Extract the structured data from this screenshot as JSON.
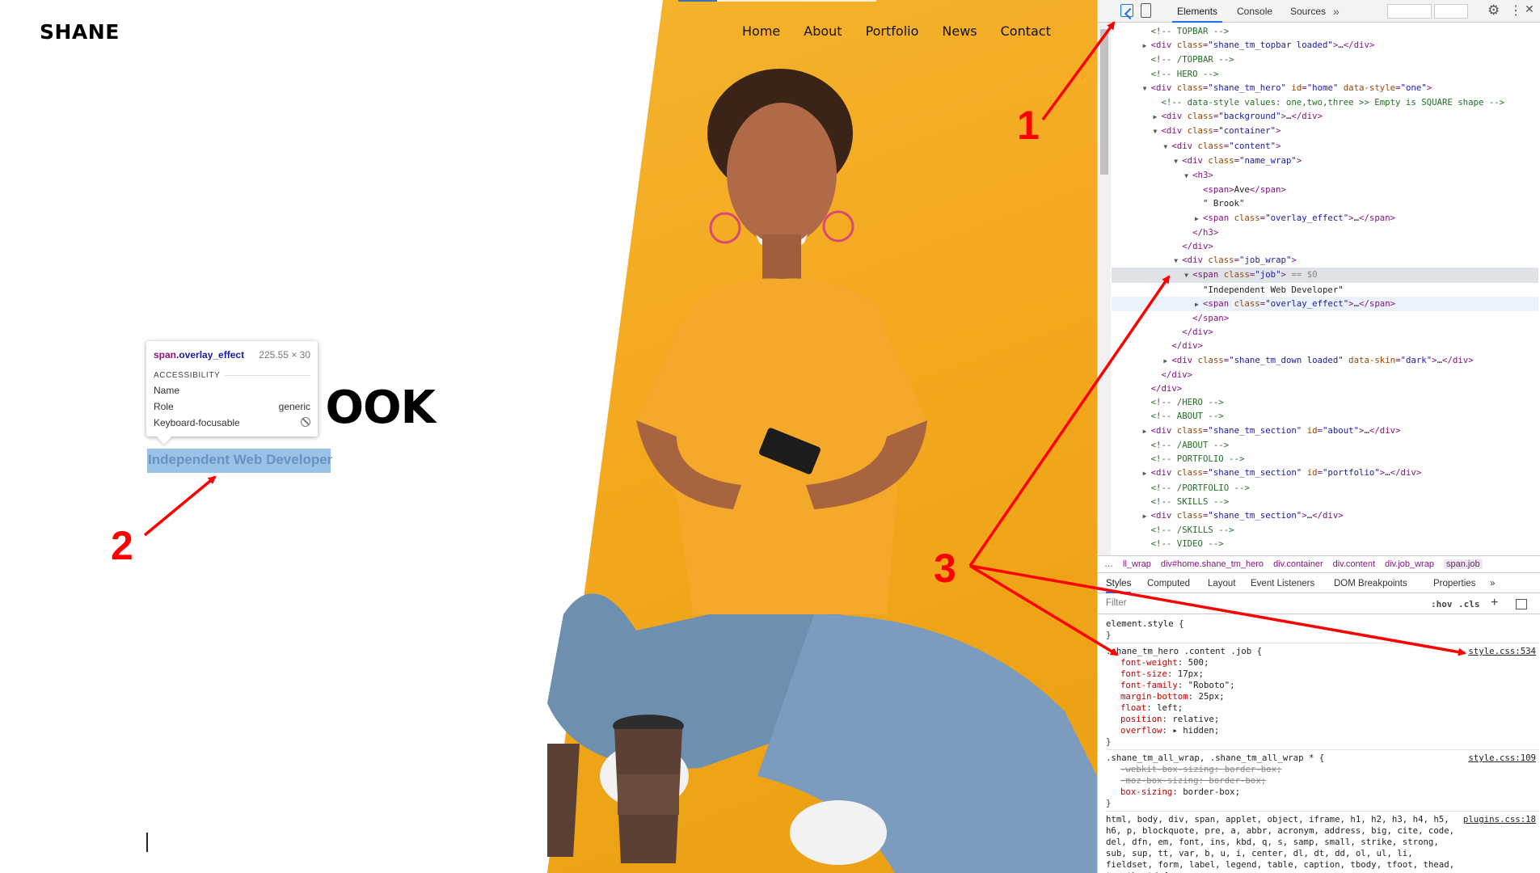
{
  "website": {
    "logo": "SHANE",
    "nav": [
      "Home",
      "About",
      "Portfolio",
      "News",
      "Contact"
    ],
    "hero_name_visible": "OOK",
    "job_text": "Independent Web Developer"
  },
  "tooltip": {
    "element_tag": "span",
    "element_class": ".overlay_effect",
    "size": "225.55 × 30",
    "section": "ACCESSIBILITY",
    "rows": [
      {
        "label": "Name",
        "value": ""
      },
      {
        "label": "Role",
        "value": "generic"
      },
      {
        "label": "Keyboard-focusable",
        "value": ""
      }
    ]
  },
  "devtools": {
    "tabs": [
      "Elements",
      "Console",
      "Sources"
    ],
    "active_tab": "Elements",
    "dom": [
      {
        "indent": 4,
        "arrow": "",
        "parts": [
          [
            "c",
            "<!-- TOPBAR -->"
          ]
        ]
      },
      {
        "indent": 4,
        "arrow": "▶",
        "parts": [
          [
            "t",
            "<div "
          ],
          [
            "a",
            "class"
          ],
          [
            "t",
            "="
          ],
          [
            "v",
            "\"shane_tm_topbar loaded\""
          ],
          [
            "t",
            ">"
          ],
          [
            "x",
            "…"
          ],
          [
            "t",
            "</div>"
          ]
        ]
      },
      {
        "indent": 4,
        "arrow": "",
        "parts": [
          [
            "c",
            "<!-- /TOPBAR -->"
          ]
        ]
      },
      {
        "indent": 4,
        "arrow": "",
        "parts": [
          [
            "c",
            "<!-- HERO -->"
          ]
        ]
      },
      {
        "indent": 4,
        "arrow": "▼",
        "parts": [
          [
            "t",
            "<div "
          ],
          [
            "a",
            "class"
          ],
          [
            "t",
            "="
          ],
          [
            "v",
            "\"shane_tm_hero\""
          ],
          [
            "t",
            " "
          ],
          [
            "a",
            "id"
          ],
          [
            "t",
            "="
          ],
          [
            "v",
            "\"home\""
          ],
          [
            "t",
            " "
          ],
          [
            "a",
            "data-style"
          ],
          [
            "t",
            "="
          ],
          [
            "v",
            "\"one\""
          ],
          [
            "t",
            ">"
          ]
        ]
      },
      {
        "indent": 5,
        "arrow": "",
        "parts": [
          [
            "c",
            "<!-- data-style values: one,two,three >> Empty is SQUARE shape -->"
          ]
        ]
      },
      {
        "indent": 5,
        "arrow": "▶",
        "parts": [
          [
            "t",
            "<div "
          ],
          [
            "a",
            "class"
          ],
          [
            "t",
            "="
          ],
          [
            "v",
            "\"background\""
          ],
          [
            "t",
            ">"
          ],
          [
            "x",
            "…"
          ],
          [
            "t",
            "</div>"
          ]
        ]
      },
      {
        "indent": 5,
        "arrow": "▼",
        "parts": [
          [
            "t",
            "<div "
          ],
          [
            "a",
            "class"
          ],
          [
            "t",
            "="
          ],
          [
            "v",
            "\"container\""
          ],
          [
            "t",
            ">"
          ]
        ]
      },
      {
        "indent": 6,
        "arrow": "▼",
        "parts": [
          [
            "t",
            "<div "
          ],
          [
            "a",
            "class"
          ],
          [
            "t",
            "="
          ],
          [
            "v",
            "\"content\""
          ],
          [
            "t",
            ">"
          ]
        ]
      },
      {
        "indent": 7,
        "arrow": "▼",
        "parts": [
          [
            "t",
            "<div "
          ],
          [
            "a",
            "class"
          ],
          [
            "t",
            "="
          ],
          [
            "v",
            "\"name_wrap\""
          ],
          [
            "t",
            ">"
          ]
        ]
      },
      {
        "indent": 8,
        "arrow": "▼",
        "parts": [
          [
            "t",
            "<h3>"
          ]
        ]
      },
      {
        "indent": 9,
        "arrow": "",
        "parts": [
          [
            "t",
            "<span>"
          ],
          [
            "x",
            "Ave"
          ],
          [
            "t",
            "</span>"
          ]
        ]
      },
      {
        "indent": 9,
        "arrow": "",
        "parts": [
          [
            "x",
            "\" Brook\""
          ]
        ]
      },
      {
        "indent": 9,
        "arrow": "▶",
        "parts": [
          [
            "t",
            "<span "
          ],
          [
            "a",
            "class"
          ],
          [
            "t",
            "="
          ],
          [
            "v",
            "\"overlay_effect\""
          ],
          [
            "t",
            ">"
          ],
          [
            "x",
            "…"
          ],
          [
            "t",
            "</span>"
          ]
        ]
      },
      {
        "indent": 8,
        "arrow": "",
        "parts": [
          [
            "t",
            "</h3>"
          ]
        ]
      },
      {
        "indent": 7,
        "arrow": "",
        "parts": [
          [
            "t",
            "</div>"
          ]
        ]
      },
      {
        "indent": 7,
        "arrow": "▼",
        "parts": [
          [
            "t",
            "<div "
          ],
          [
            "a",
            "class"
          ],
          [
            "t",
            "="
          ],
          [
            "v",
            "\"job_wrap\""
          ],
          [
            "t",
            ">"
          ]
        ]
      },
      {
        "indent": 8,
        "arrow": "▼",
        "state": "selected",
        "parts": [
          [
            "t",
            "<span "
          ],
          [
            "a",
            "class"
          ],
          [
            "t",
            "="
          ],
          [
            "v",
            "\"job\""
          ],
          [
            "t",
            ">"
          ],
          [
            "d",
            " == $0"
          ]
        ]
      },
      {
        "indent": 9,
        "arrow": "",
        "parts": [
          [
            "x",
            "\"Independent Web Developer\""
          ]
        ]
      },
      {
        "indent": 9,
        "arrow": "▶",
        "state": "hovered",
        "parts": [
          [
            "t",
            "<span "
          ],
          [
            "a",
            "class"
          ],
          [
            "t",
            "="
          ],
          [
            "v",
            "\"overlay_effect\""
          ],
          [
            "t",
            ">"
          ],
          [
            "x",
            "…"
          ],
          [
            "t",
            "</span>"
          ]
        ]
      },
      {
        "indent": 8,
        "arrow": "",
        "parts": [
          [
            "t",
            "</span>"
          ]
        ]
      },
      {
        "indent": 7,
        "arrow": "",
        "parts": [
          [
            "t",
            "</div>"
          ]
        ]
      },
      {
        "indent": 6,
        "arrow": "",
        "parts": [
          [
            "t",
            "</div>"
          ]
        ]
      },
      {
        "indent": 6,
        "arrow": "▶",
        "parts": [
          [
            "t",
            "<div "
          ],
          [
            "a",
            "class"
          ],
          [
            "t",
            "="
          ],
          [
            "v",
            "\"shane_tm_down loaded\""
          ],
          [
            "t",
            " "
          ],
          [
            "a",
            "data-skin"
          ],
          [
            "t",
            "="
          ],
          [
            "v",
            "\"dark\""
          ],
          [
            "t",
            ">"
          ],
          [
            "x",
            "…"
          ],
          [
            "t",
            "</div>"
          ]
        ]
      },
      {
        "indent": 5,
        "arrow": "",
        "parts": [
          [
            "t",
            "</div>"
          ]
        ]
      },
      {
        "indent": 4,
        "arrow": "",
        "parts": [
          [
            "t",
            "</div>"
          ]
        ]
      },
      {
        "indent": 4,
        "arrow": "",
        "parts": [
          [
            "c",
            "<!-- /HERO -->"
          ]
        ]
      },
      {
        "indent": 4,
        "arrow": "",
        "parts": [
          [
            "c",
            "<!-- ABOUT -->"
          ]
        ]
      },
      {
        "indent": 4,
        "arrow": "▶",
        "parts": [
          [
            "t",
            "<div "
          ],
          [
            "a",
            "class"
          ],
          [
            "t",
            "="
          ],
          [
            "v",
            "\"shane_tm_section\""
          ],
          [
            "t",
            " "
          ],
          [
            "a",
            "id"
          ],
          [
            "t",
            "="
          ],
          [
            "v",
            "\"about\""
          ],
          [
            "t",
            ">"
          ],
          [
            "x",
            "…"
          ],
          [
            "t",
            "</div>"
          ]
        ]
      },
      {
        "indent": 4,
        "arrow": "",
        "parts": [
          [
            "c",
            "<!-- /ABOUT -->"
          ]
        ]
      },
      {
        "indent": 4,
        "arrow": "",
        "parts": [
          [
            "c",
            "<!-- PORTFOLIO -->"
          ]
        ]
      },
      {
        "indent": 4,
        "arrow": "▶",
        "parts": [
          [
            "t",
            "<div "
          ],
          [
            "a",
            "class"
          ],
          [
            "t",
            "="
          ],
          [
            "v",
            "\"shane_tm_section\""
          ],
          [
            "t",
            " "
          ],
          [
            "a",
            "id"
          ],
          [
            "t",
            "="
          ],
          [
            "v",
            "\"portfolio\""
          ],
          [
            "t",
            ">"
          ],
          [
            "x",
            "…"
          ],
          [
            "t",
            "</div>"
          ]
        ]
      },
      {
        "indent": 4,
        "arrow": "",
        "parts": [
          [
            "c",
            "<!-- /PORTFOLIO -->"
          ]
        ]
      },
      {
        "indent": 4,
        "arrow": "",
        "parts": [
          [
            "c",
            "<!-- SKILLS -->"
          ]
        ]
      },
      {
        "indent": 4,
        "arrow": "▶",
        "parts": [
          [
            "t",
            "<div "
          ],
          [
            "a",
            "class"
          ],
          [
            "t",
            "="
          ],
          [
            "v",
            "\"shane_tm_section\""
          ],
          [
            "t",
            ">"
          ],
          [
            "x",
            "…"
          ],
          [
            "t",
            "</div>"
          ]
        ]
      },
      {
        "indent": 4,
        "arrow": "",
        "parts": [
          [
            "c",
            "<!-- /SKILLS -->"
          ]
        ]
      },
      {
        "indent": 4,
        "arrow": "",
        "parts": [
          [
            "c",
            "<!-- VIDEO -->"
          ]
        ]
      },
      {
        "indent": 4,
        "arrow": "▶",
        "parts": [
          [
            "t",
            "<div "
          ],
          [
            "a",
            "class"
          ],
          [
            "t",
            "="
          ],
          [
            "v",
            "\"shane_tm_section\""
          ],
          [
            "t",
            ">"
          ],
          [
            "x",
            "…"
          ],
          [
            "t",
            "</div>"
          ]
        ]
      }
    ],
    "breadcrumb": [
      "…",
      "ll_wrap",
      "div#home.shane_tm_hero",
      "div.container",
      "div.content",
      "div.job_wrap",
      "span.job"
    ],
    "style_tabs": [
      "Styles",
      "Computed",
      "Layout",
      "Event Listeners",
      "DOM Breakpoints",
      "Properties"
    ],
    "filter_placeholder": "Filter",
    "hov_label": ":hov",
    "cls_label": ".cls",
    "rules": [
      {
        "selector": "element.style {",
        "source": "",
        "props": [],
        "close": "}"
      },
      {
        "selector": ".shane_tm_hero .content .job {",
        "source": "style.css:534",
        "props": [
          {
            "name": "font-weight",
            "value": "500;"
          },
          {
            "name": "font-size",
            "value": "17px;"
          },
          {
            "name": "font-family",
            "value": "\"Roboto\";"
          },
          {
            "name": "margin-bottom",
            "value": "25px;"
          },
          {
            "name": "float",
            "value": "left;"
          },
          {
            "name": "position",
            "value": "relative;"
          },
          {
            "name": "overflow",
            "value": "▸ hidden;"
          }
        ],
        "close": "}"
      },
      {
        "selector": ".shane_tm_all_wrap, .shane_tm_all_wrap * {",
        "source": "style.css:109",
        "props": [
          {
            "name": "-webkit-box-sizing",
            "value": "border-box;",
            "struck": true
          },
          {
            "name": "-moz-box-sizing",
            "value": "border-box;",
            "struck": true
          },
          {
            "name": "box-sizing",
            "value": "border-box;"
          }
        ],
        "close": "}"
      },
      {
        "selector": "html, body, div, span, applet, object, iframe, h1, h2, h3, h4, h5, h6, p, blockquote, pre, a, abbr, acronym, address, big, cite, code, del, dfn, em, font, ins, kbd, q, s, samp, small, strike, strong, sub, sup, tt, var, b, u, i, center, dl, dt, dd, ol, ul, li, fieldset, form, label, legend, table, caption, tbody, tfoot, thead, tr, th, td {",
        "source": "plugins.css:18",
        "props": [],
        "close": ""
      }
    ]
  },
  "annotations": [
    "1",
    "2",
    "3"
  ],
  "colors": {
    "hero_yellow": "#f3a81e",
    "annotation_red": "#ff0000",
    "highlight_blue": "#6fa8dc",
    "devtools_accent": "#1a73e8"
  }
}
